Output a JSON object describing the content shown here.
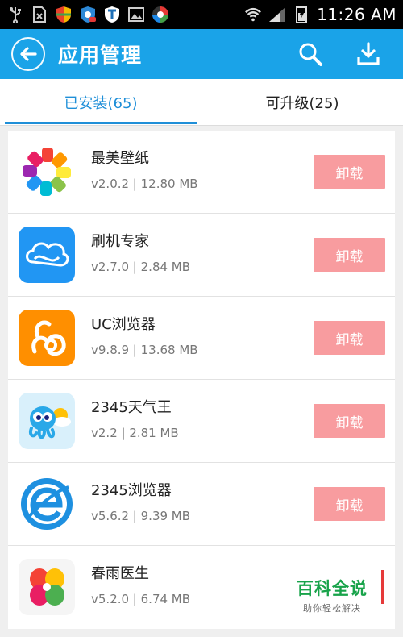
{
  "status_bar": {
    "time": "11:26 AM",
    "left_icons": [
      "usb-icon",
      "sim-off-icon",
      "shield-security-icon",
      "shield-badge-icon",
      "shield-t-icon",
      "image-icon",
      "circle-app-icon"
    ],
    "right_icons": [
      "wifi-icon",
      "signal-icon",
      "battery-icon"
    ]
  },
  "header": {
    "title": "应用管理",
    "back_icon": "back-arrow-icon",
    "search_icon": "search-icon",
    "download_icon": "download-icon",
    "color": "#1aa3e8"
  },
  "tabs": [
    {
      "label": "已安装(65)",
      "active": true
    },
    {
      "label": "可升级(25)",
      "active": false
    }
  ],
  "apps": [
    {
      "name": "最美壁纸",
      "meta": "v2.0.2 | 12.80 MB",
      "button": "卸载",
      "icon": "colorful-pinwheel-icon"
    },
    {
      "name": "刷机专家",
      "meta": "v2.7.0 | 2.84 MB",
      "button": "卸载",
      "icon": "cloud-icon"
    },
    {
      "name": "UC浏览器",
      "meta": "v9.8.9 | 13.68 MB",
      "button": "卸载",
      "icon": "squirrel-icon"
    },
    {
      "name": "2345天气王",
      "meta": "v2.2 | 2.81 MB",
      "button": "卸载",
      "icon": "octopus-weather-icon"
    },
    {
      "name": "2345浏览器",
      "meta": "v5.6.2 | 9.39 MB",
      "button": "卸载",
      "icon": "browser-e-icon"
    },
    {
      "name": "春雨医生",
      "meta": "v5.2.0 | 6.74 MB",
      "button": "",
      "icon": "clover-icon"
    }
  ],
  "watermark": {
    "title": "百科全说",
    "subtitle": "助你轻松解决"
  },
  "colors": {
    "accent": "#1aa3e8",
    "tab_active": "#1f8fd8",
    "uninstall_button": "#f89c9f"
  }
}
